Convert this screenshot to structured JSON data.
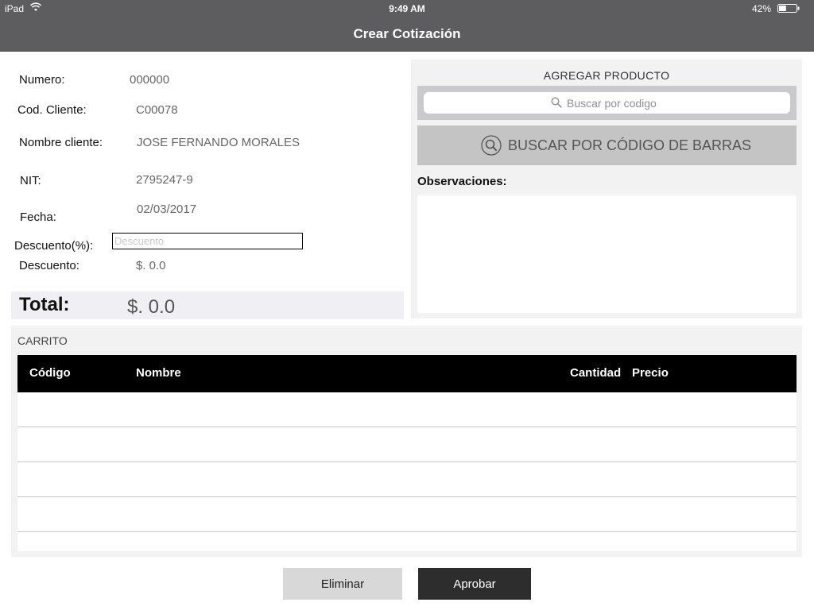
{
  "status_bar": {
    "device": "iPad",
    "time": "9:49 AM",
    "battery_percent": "42%",
    "battery_level": 0.42
  },
  "nav": {
    "title": "Crear Cotización"
  },
  "form": {
    "numero_label": "Numero:",
    "numero_value": "000000",
    "cod_cliente_label": "Cod. Cliente:",
    "cod_cliente_value": "C00078",
    "nombre_label": "Nombre cliente:",
    "nombre_value": "JOSE FERNANDO MORALES",
    "nit_label": "NIT:",
    "nit_value": "2795247-9",
    "fecha_label": "Fecha:",
    "fecha_value": "02/03/2017",
    "descuento_pct_label": "Descuento(%):",
    "descuento_pct_placeholder": "Descuento",
    "descuento_label": "Descuento:",
    "descuento_value": "$. 0.0",
    "total_label": "Total:",
    "total_value": "$. 0.0"
  },
  "product_panel": {
    "title": "AGREGAR PRODUCTO",
    "search_placeholder": "Buscar por codigo",
    "barcode_button": "BUSCAR POR CÓDIGO DE BARRAS",
    "observations_label": "Observaciones:",
    "observations_value": ""
  },
  "cart": {
    "title": "CARRITO",
    "columns": {
      "codigo": "Código",
      "nombre": "Nombre",
      "cantidad": "Cantidad",
      "precio": "Precio"
    },
    "rows": []
  },
  "actions": {
    "delete_label": "Eliminar",
    "approve_label": "Aprobar"
  },
  "colors": {
    "bar": "#5d5d5f",
    "panel": "#f2f2f2",
    "header_black": "#000000",
    "approve": "#2d2d2d",
    "delete": "#d8d8d8"
  }
}
